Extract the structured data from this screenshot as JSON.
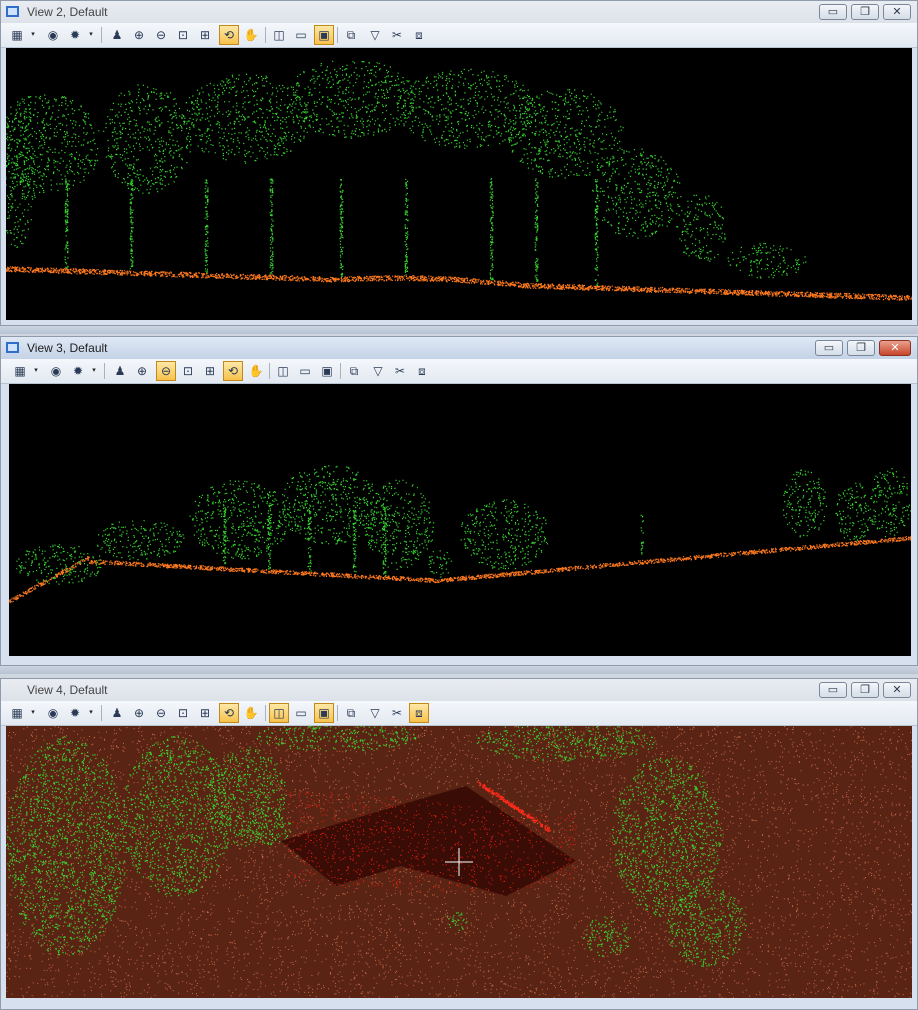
{
  "windows": [
    {
      "id": "view2",
      "title": "View 2, Default",
      "close_style": "normal"
    },
    {
      "id": "view3",
      "title": "View 3, Default",
      "close_style": "red"
    },
    {
      "id": "view4",
      "title": "View 4, Default",
      "close_style": "normal"
    }
  ],
  "window_buttons": {
    "minimize": "▭",
    "maximize": "❐",
    "close": "✕"
  },
  "toolbar_icons": [
    "▦",
    "◉",
    "✹",
    "♟",
    "⊕",
    "⊖",
    "⊡",
    "⊞",
    "⟲",
    "✋",
    "◫",
    "▭",
    "▣",
    "⧉",
    "▽",
    "✂",
    "⧈"
  ],
  "toolbar_caret": "▾",
  "colors": {
    "vegetation": "#37d42f",
    "ground": "#ff7a1e",
    "building": "#e01e12",
    "ground_surface": "#5a2414",
    "background": "#000000"
  }
}
